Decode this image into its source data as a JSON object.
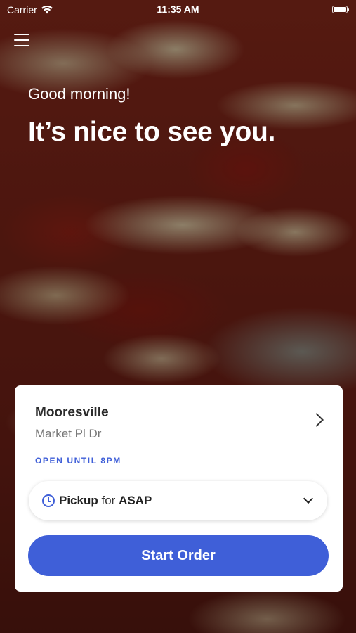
{
  "status_bar": {
    "carrier": "Carrier",
    "time": "11:35 AM",
    "icons": [
      "wifi-icon",
      "battery-icon"
    ]
  },
  "header": {
    "menu_icon": "hamburger-menu-icon",
    "greeting": "Good morning!",
    "headline": "It’s nice to see you."
  },
  "location_card": {
    "name": "Mooresville",
    "street": "Market Pl Dr",
    "hours": "OPEN UNTIL 8PM",
    "chevron_icon": "chevron-right-icon",
    "order_mode": {
      "icon": "clock-icon",
      "mode": "Pickup",
      "connector": "for",
      "time": "ASAP",
      "dropdown_icon": "chevron-down-icon"
    },
    "start_button_label": "Start Order"
  },
  "colors": {
    "accent": "#3f5fd8",
    "card_background": "#ffffff",
    "text_primary": "#2b2b2b",
    "text_secondary": "#777777"
  }
}
